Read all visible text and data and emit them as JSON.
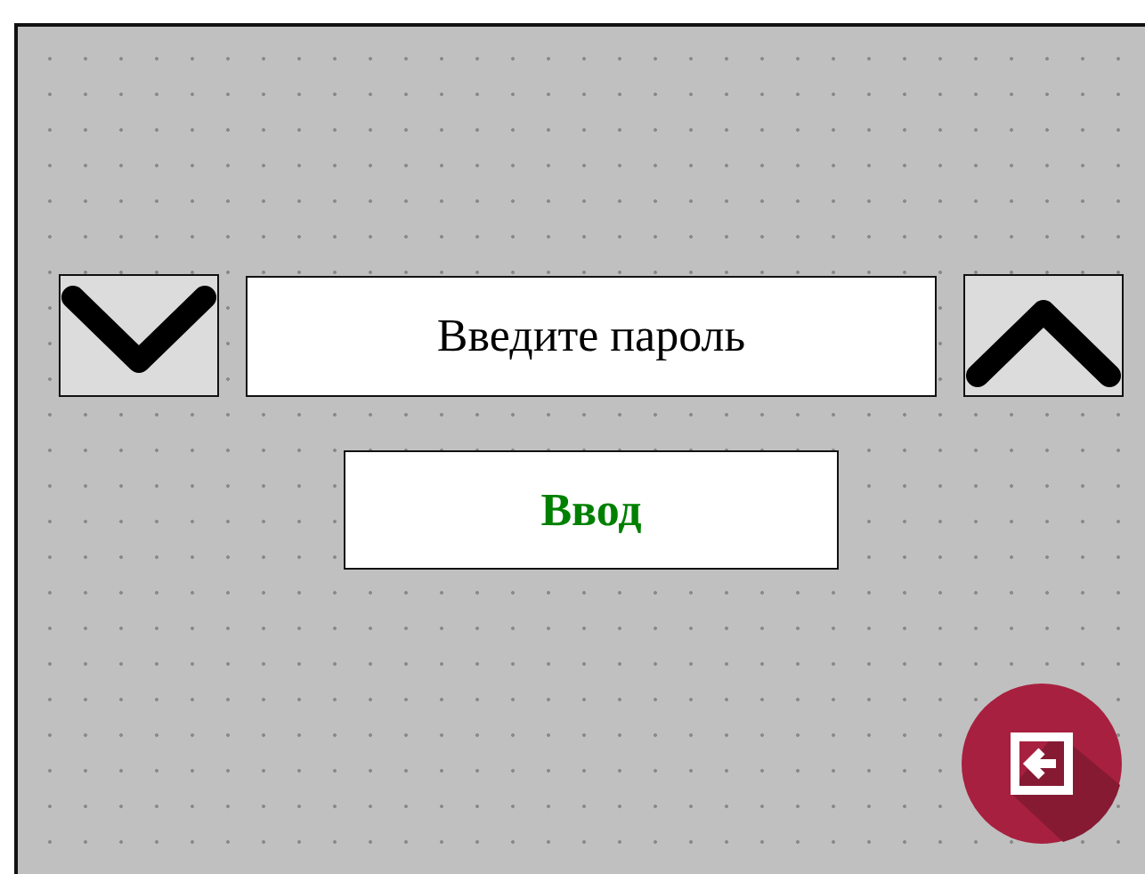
{
  "password_field": {
    "placeholder": "Введите пароль"
  },
  "enter_button": {
    "label": "Ввод"
  }
}
